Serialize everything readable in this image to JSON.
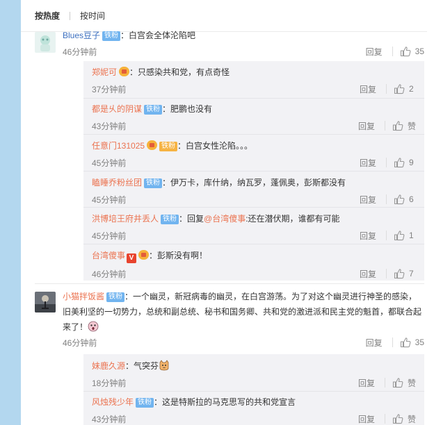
{
  "sort": {
    "hot": "按热度",
    "time": "按时间"
  },
  "badge_fan": "铁粉",
  "reply_label": "回复",
  "comments": [
    {
      "user": "Blues豆子",
      "text": "：白宫会全体沦陷吧",
      "time": "46分钟前",
      "likes": "35",
      "replies": [
        {
          "user": "郑妮可",
          "text": "：只感染共和党，有点奇怪",
          "time": "37分钟前",
          "likes": "2"
        },
        {
          "user": "都是乆的阴谋",
          "text": "：肥鹏也没有",
          "time": "43分钟前",
          "likes": "赞"
        },
        {
          "user": "任意门131025",
          "text": "：白宫女性沦陷。。。",
          "time": "45分钟前",
          "likes": "9"
        },
        {
          "user": "瞌睡乔粉丝团",
          "text": "：伊万卡，库什纳，纳瓦罗，蓬佩奥，彭斯都没有",
          "time": "45分钟前",
          "likes": "6"
        },
        {
          "user": "洪博培王府井丢人",
          "text_pre": "：回复",
          "at_user": "@台湾傻事",
          "text_post": ":还在潜伏期，谁都有可能",
          "time": "45分钟前",
          "likes": "1"
        },
        {
          "user": "台湾傻事",
          "text": "：彭斯没有啊！",
          "time": "46分钟前",
          "likes": "7"
        }
      ]
    },
    {
      "user": "小猫拌饭酱",
      "text_line1": "：一个幽灵，新冠病毒的幽灵，在白宫游荡。为了对这个幽灵进行神圣的感染，",
      "text_line2": "旧美利坚的一切势力，总统和副总统、秘书和国务卿、共和党的激进派和民主党的魁首，都联合起",
      "text_line3": "来了！",
      "time": "46分钟前",
      "likes": "35",
      "replies": [
        {
          "user": "妹鹿久源",
          "text": "：气突芬",
          "time": "18分钟前",
          "likes": "赞"
        },
        {
          "user": "风烛残少年",
          "text": "：这是特斯拉的马克思写的共和党宣言",
          "time": "43分钟前",
          "likes": "赞"
        }
      ]
    }
  ]
}
